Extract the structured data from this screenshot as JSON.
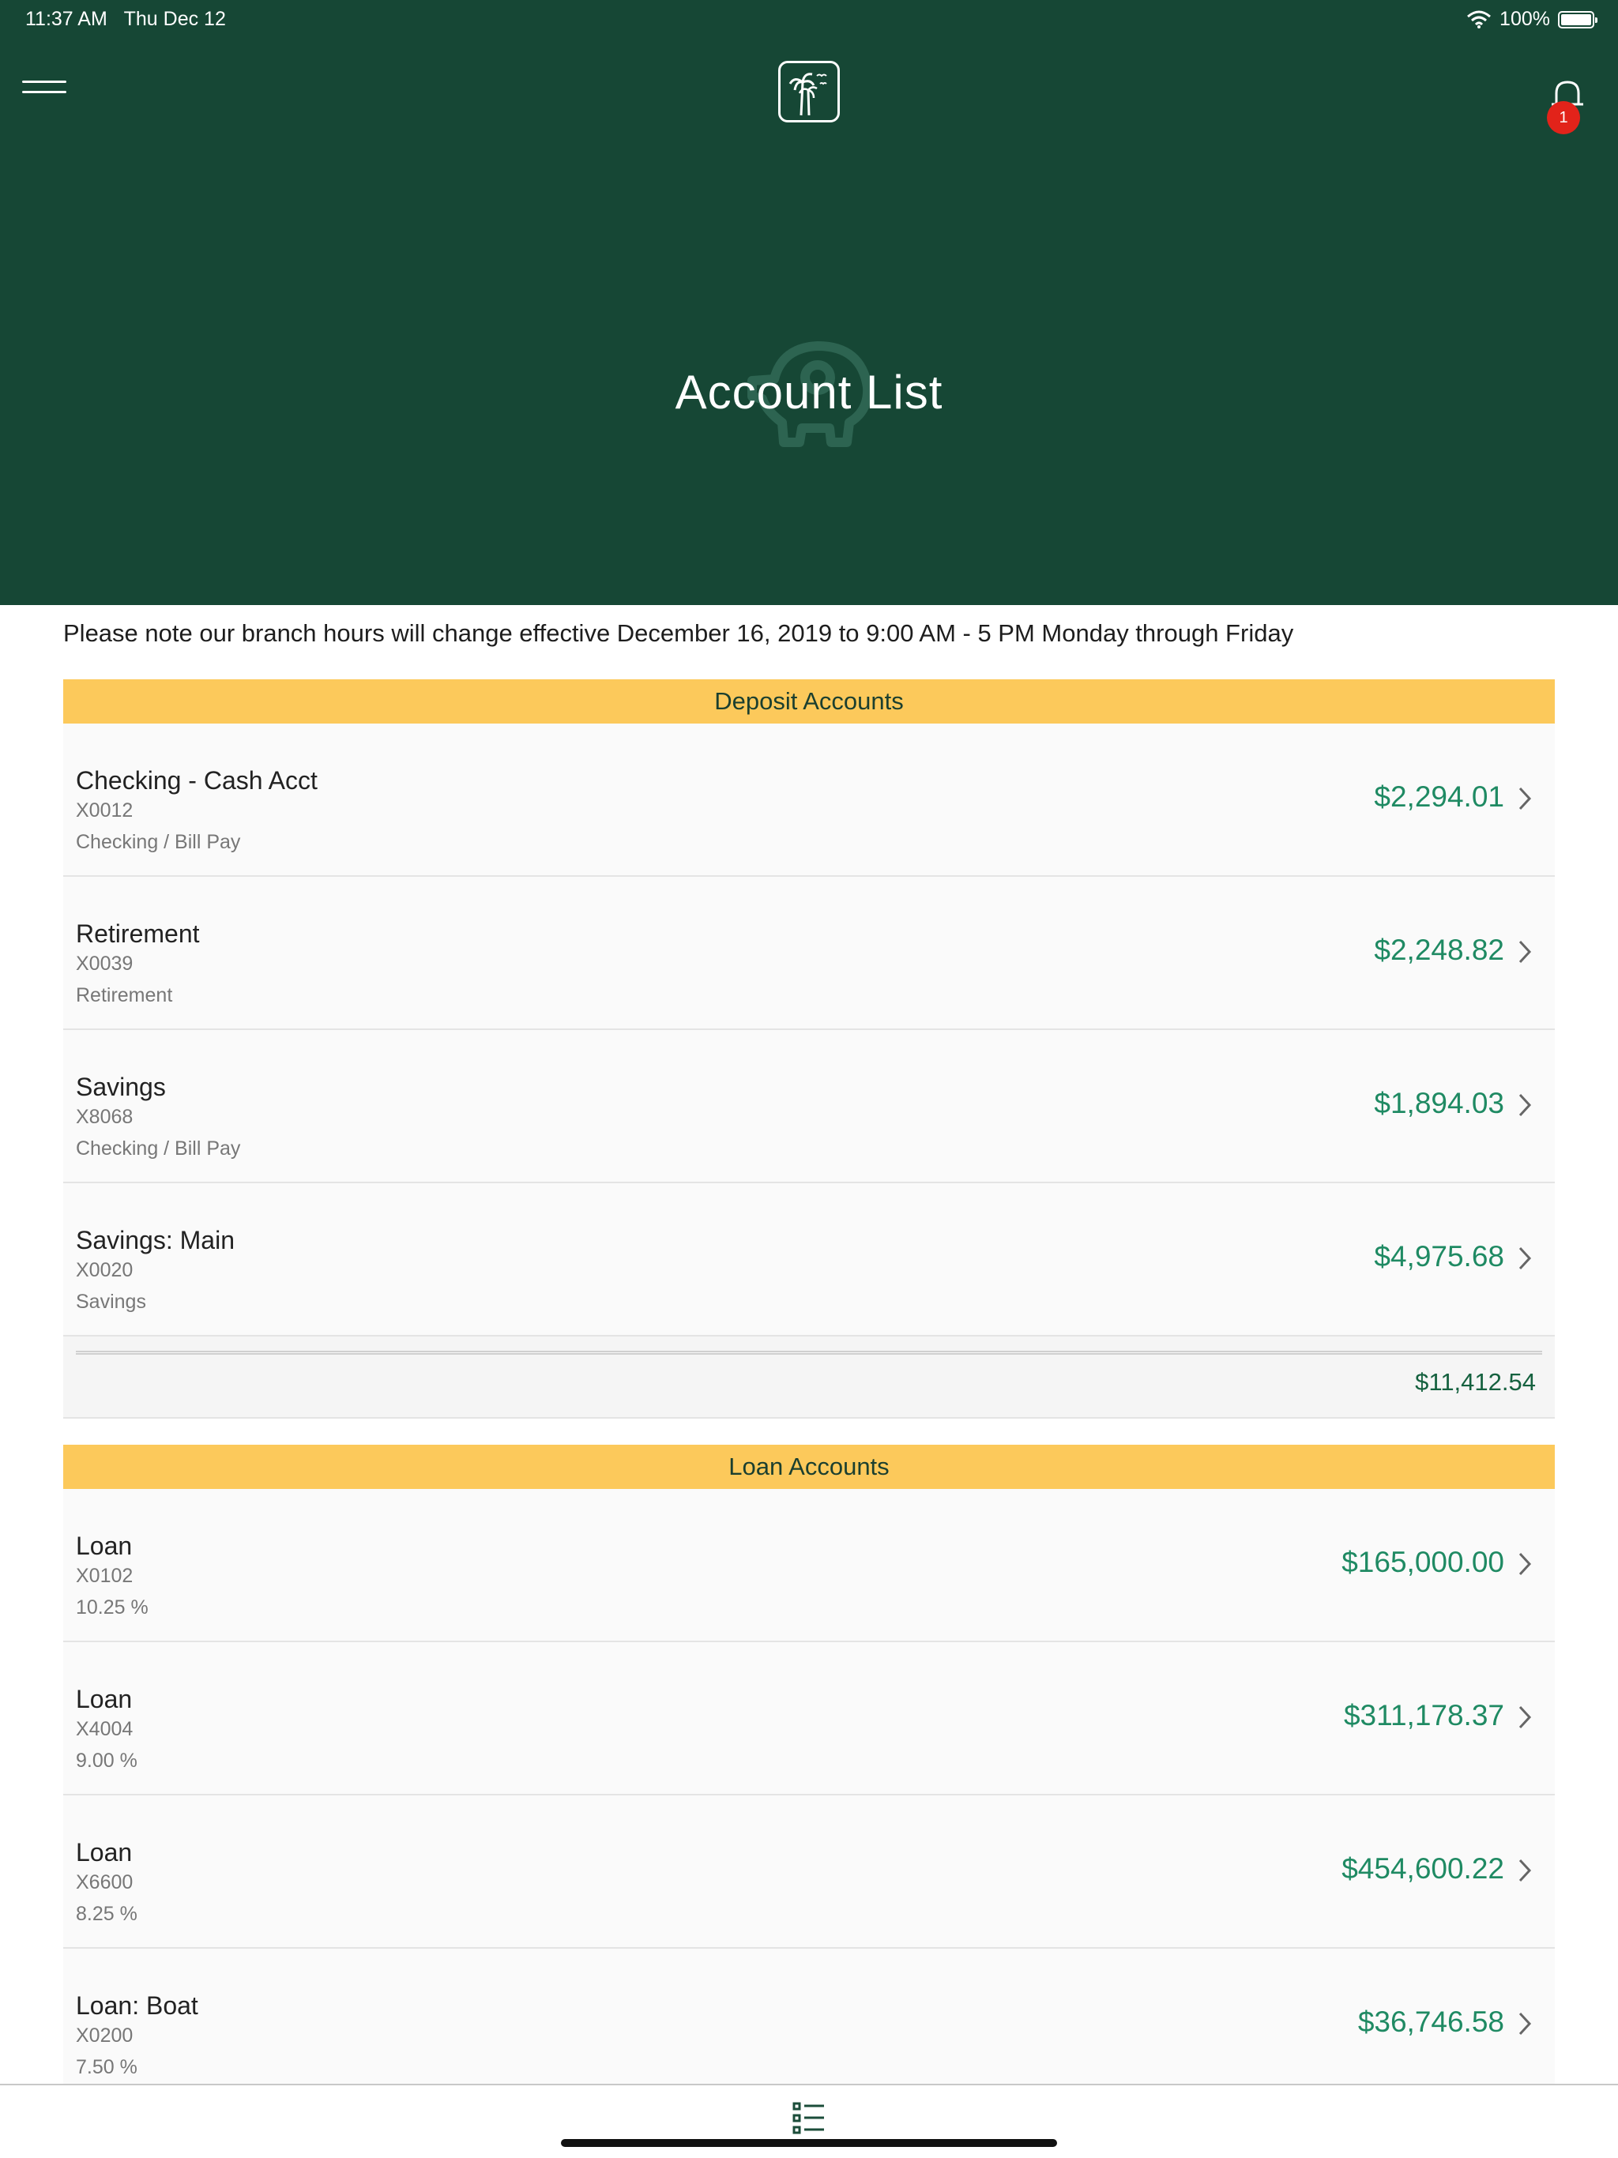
{
  "status_bar": {
    "time": "11:37 AM",
    "date": "Thu Dec 12",
    "battery": "100%"
  },
  "header": {
    "title": "Account List",
    "notification_count": "1"
  },
  "notice": "Please note our branch hours will change effective December 16, 2019 to 9:00 AM - 5 PM Monday through Friday",
  "deposit": {
    "title": "Deposit Accounts",
    "accounts": [
      {
        "name": "Checking - Cash Acct",
        "number": "X0012",
        "type": "Checking / Bill Pay",
        "balance": "$2,294.01"
      },
      {
        "name": "Retirement",
        "number": "X0039",
        "type": "Retirement",
        "balance": "$2,248.82"
      },
      {
        "name": "Savings",
        "number": "X8068",
        "type": "Checking / Bill Pay",
        "balance": "$1,894.03"
      },
      {
        "name": "Savings: Main",
        "number": "X0020",
        "type": "Savings",
        "balance": "$4,975.68"
      }
    ],
    "total": "$11,412.54"
  },
  "loan": {
    "title": "Loan Accounts",
    "accounts": [
      {
        "name": "Loan",
        "number": "X0102",
        "rate": "10.25 %",
        "balance": "$165,000.00"
      },
      {
        "name": "Loan",
        "number": "X4004",
        "rate": "9.00 %",
        "balance": "$311,178.37"
      },
      {
        "name": "Loan",
        "number": "X6600",
        "rate": "8.25 %",
        "balance": "$454,600.22"
      },
      {
        "name": "Loan: Boat",
        "number": "X0200",
        "rate": "7.50 %",
        "balance": "$36,746.58"
      }
    ]
  },
  "colors": {
    "header_bg": "#164735",
    "section_bg": "#fcc95b",
    "amount": "#1f8a63",
    "badge": "#e2231a"
  },
  "icons": [
    "hamburger-menu-icon",
    "palm-tree-logo-icon",
    "bell-icon",
    "piggy-bank-icon",
    "chevron-right-icon",
    "list-icon",
    "wifi-icon",
    "battery-icon"
  ]
}
